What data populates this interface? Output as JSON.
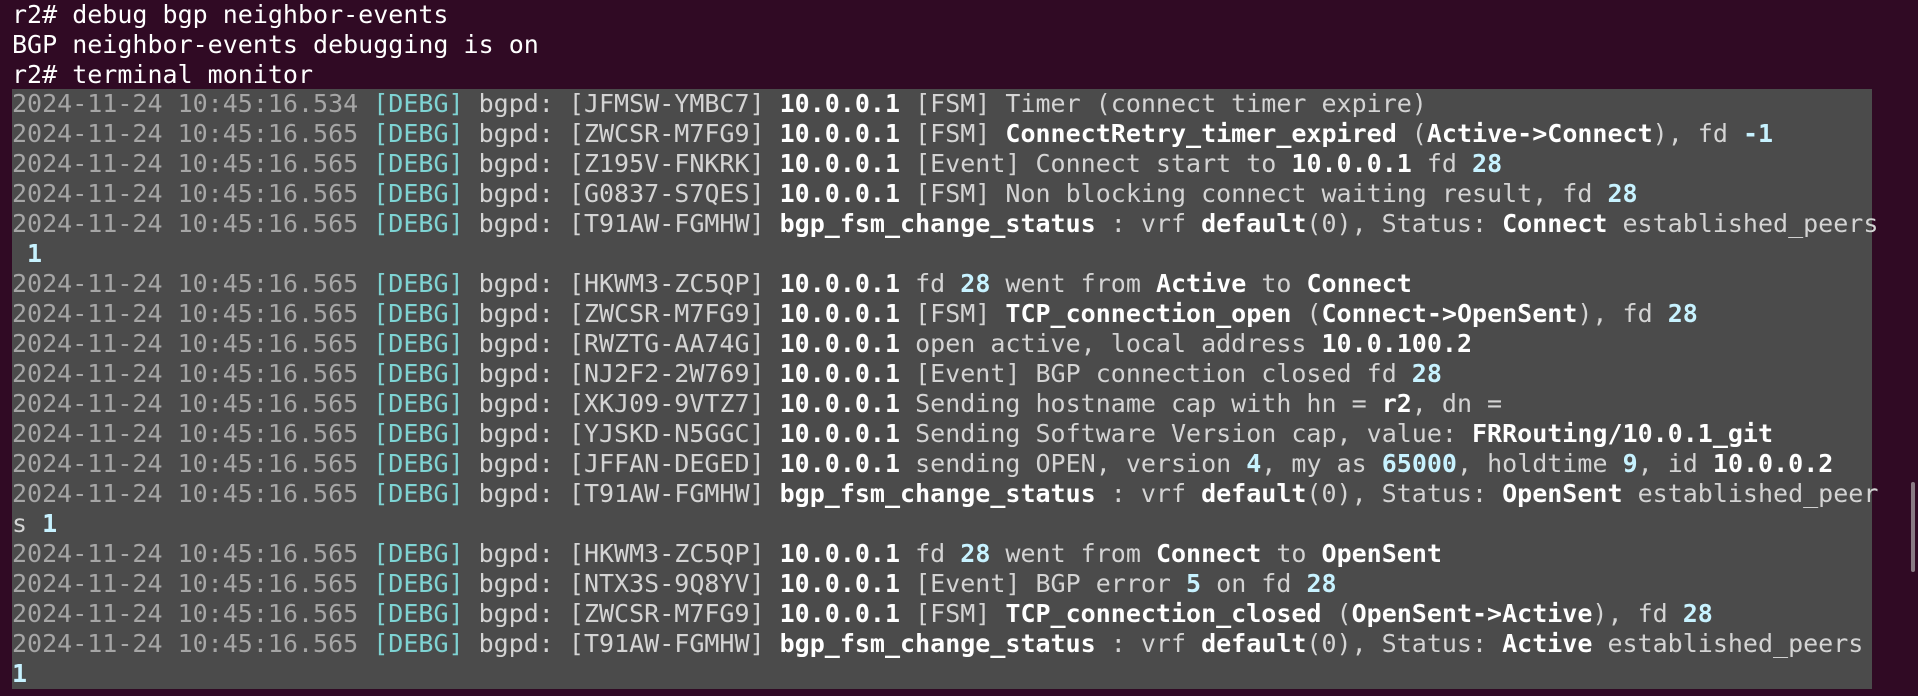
{
  "prompt": [
    "r2# debug bgp neighbor-events",
    "BGP neighbor-events debugging is on",
    "r2# terminal monitor"
  ],
  "lines": [
    {
      "segs": [
        {
          "t": "2024-11-24 10:45:16.534 ",
          "c": "ts"
        },
        {
          "t": "[DEBG]",
          "c": "lvl"
        },
        {
          "t": " bgpd: [JFMSW-YMBC7] ",
          "c": "dim"
        },
        {
          "t": "10.0.0.1",
          "c": "hi"
        },
        {
          "t": " [FSM] Timer (connect timer expire)",
          "c": "dim"
        }
      ]
    },
    {
      "segs": [
        {
          "t": "2024-11-24 10:45:16.565 ",
          "c": "ts"
        },
        {
          "t": "[DEBG]",
          "c": "lvl"
        },
        {
          "t": " bgpd: [ZWCSR-M7FG9] ",
          "c": "dim"
        },
        {
          "t": "10.0.0.1",
          "c": "hi"
        },
        {
          "t": " [FSM] ",
          "c": "dim"
        },
        {
          "t": "ConnectRetry_timer_expired",
          "c": "hi"
        },
        {
          "t": " (",
          "c": "dim"
        },
        {
          "t": "Active->Connect",
          "c": "hi"
        },
        {
          "t": "), fd ",
          "c": "dim"
        },
        {
          "t": "-1",
          "c": "num"
        }
      ]
    },
    {
      "segs": [
        {
          "t": "2024-11-24 10:45:16.565 ",
          "c": "ts"
        },
        {
          "t": "[DEBG]",
          "c": "lvl"
        },
        {
          "t": " bgpd: [Z195V-FNKRK] ",
          "c": "dim"
        },
        {
          "t": "10.0.0.1",
          "c": "hi"
        },
        {
          "t": " [Event] Connect start to ",
          "c": "dim"
        },
        {
          "t": "10.0.0.1",
          "c": "hi"
        },
        {
          "t": " fd ",
          "c": "dim"
        },
        {
          "t": "28",
          "c": "num"
        }
      ]
    },
    {
      "segs": [
        {
          "t": "2024-11-24 10:45:16.565 ",
          "c": "ts"
        },
        {
          "t": "[DEBG]",
          "c": "lvl"
        },
        {
          "t": " bgpd: [G0837-S7QES] ",
          "c": "dim"
        },
        {
          "t": "10.0.0.1",
          "c": "hi"
        },
        {
          "t": " [FSM] Non blocking connect waiting result, fd ",
          "c": "dim"
        },
        {
          "t": "28",
          "c": "num"
        }
      ]
    },
    {
      "segs": [
        {
          "t": "2024-11-24 10:45:16.565 ",
          "c": "ts"
        },
        {
          "t": "[DEBG]",
          "c": "lvl"
        },
        {
          "t": " bgpd: [T91AW-FGMHW] ",
          "c": "dim"
        },
        {
          "t": "bgp_fsm_change_status",
          "c": "hi"
        },
        {
          "t": " : vrf ",
          "c": "dim"
        },
        {
          "t": "default",
          "c": "hi"
        },
        {
          "t": "(0), Status: ",
          "c": "dim"
        },
        {
          "t": "Connect",
          "c": "hi"
        },
        {
          "t": " established_peers",
          "c": "dim"
        }
      ]
    },
    {
      "segs": [
        {
          "t": " 1",
          "c": "num"
        }
      ]
    },
    {
      "segs": [
        {
          "t": "2024-11-24 10:45:16.565 ",
          "c": "ts"
        },
        {
          "t": "[DEBG]",
          "c": "lvl"
        },
        {
          "t": " bgpd: [HKWM3-ZC5QP] ",
          "c": "dim"
        },
        {
          "t": "10.0.0.1",
          "c": "hi"
        },
        {
          "t": " fd ",
          "c": "dim"
        },
        {
          "t": "28",
          "c": "num"
        },
        {
          "t": " went from ",
          "c": "dim"
        },
        {
          "t": "Active",
          "c": "hi"
        },
        {
          "t": " to ",
          "c": "dim"
        },
        {
          "t": "Connect",
          "c": "hi"
        }
      ]
    },
    {
      "segs": [
        {
          "t": "2024-11-24 10:45:16.565 ",
          "c": "ts"
        },
        {
          "t": "[DEBG]",
          "c": "lvl"
        },
        {
          "t": " bgpd: [ZWCSR-M7FG9] ",
          "c": "dim"
        },
        {
          "t": "10.0.0.1",
          "c": "hi"
        },
        {
          "t": " [FSM] ",
          "c": "dim"
        },
        {
          "t": "TCP_connection_open",
          "c": "hi"
        },
        {
          "t": " (",
          "c": "dim"
        },
        {
          "t": "Connect->OpenSent",
          "c": "hi"
        },
        {
          "t": "), fd ",
          "c": "dim"
        },
        {
          "t": "28",
          "c": "num"
        }
      ]
    },
    {
      "segs": [
        {
          "t": "2024-11-24 10:45:16.565 ",
          "c": "ts"
        },
        {
          "t": "[DEBG]",
          "c": "lvl"
        },
        {
          "t": " bgpd: [RWZTG-AA74G] ",
          "c": "dim"
        },
        {
          "t": "10.0.0.1",
          "c": "hi"
        },
        {
          "t": " open active, local address ",
          "c": "dim"
        },
        {
          "t": "10.0.100.2",
          "c": "hi"
        }
      ]
    },
    {
      "segs": [
        {
          "t": "2024-11-24 10:45:16.565 ",
          "c": "ts"
        },
        {
          "t": "[DEBG]",
          "c": "lvl"
        },
        {
          "t": " bgpd: [NJ2F2-2W769] ",
          "c": "dim"
        },
        {
          "t": "10.0.0.1",
          "c": "hi"
        },
        {
          "t": " [Event] BGP connection closed fd ",
          "c": "dim"
        },
        {
          "t": "28",
          "c": "num"
        }
      ]
    },
    {
      "segs": [
        {
          "t": "2024-11-24 10:45:16.565 ",
          "c": "ts"
        },
        {
          "t": "[DEBG]",
          "c": "lvl"
        },
        {
          "t": " bgpd: [XKJ09-9VTZ7] ",
          "c": "dim"
        },
        {
          "t": "10.0.0.1",
          "c": "hi"
        },
        {
          "t": " Sending hostname cap with hn = ",
          "c": "dim"
        },
        {
          "t": "r2",
          "c": "hi"
        },
        {
          "t": ", dn =",
          "c": "dim"
        }
      ]
    },
    {
      "segs": [
        {
          "t": "2024-11-24 10:45:16.565 ",
          "c": "ts"
        },
        {
          "t": "[DEBG]",
          "c": "lvl"
        },
        {
          "t": " bgpd: [YJSKD-N5GGC] ",
          "c": "dim"
        },
        {
          "t": "10.0.0.1",
          "c": "hi"
        },
        {
          "t": " Sending Software Version cap, value: ",
          "c": "dim"
        },
        {
          "t": "FRRouting/10.0.1_git",
          "c": "hi"
        }
      ]
    },
    {
      "segs": [
        {
          "t": "2024-11-24 10:45:16.565 ",
          "c": "ts"
        },
        {
          "t": "[DEBG]",
          "c": "lvl"
        },
        {
          "t": " bgpd: [JFFAN-DEGED] ",
          "c": "dim"
        },
        {
          "t": "10.0.0.1",
          "c": "hi"
        },
        {
          "t": " sending OPEN, version ",
          "c": "dim"
        },
        {
          "t": "4",
          "c": "num"
        },
        {
          "t": ", my as ",
          "c": "dim"
        },
        {
          "t": "65000",
          "c": "num"
        },
        {
          "t": ", holdtime ",
          "c": "dim"
        },
        {
          "t": "9",
          "c": "num"
        },
        {
          "t": ", id ",
          "c": "dim"
        },
        {
          "t": "10.0.0.2",
          "c": "hi"
        }
      ]
    },
    {
      "segs": [
        {
          "t": "2024-11-24 10:45:16.565 ",
          "c": "ts"
        },
        {
          "t": "[DEBG]",
          "c": "lvl"
        },
        {
          "t": " bgpd: [T91AW-FGMHW] ",
          "c": "dim"
        },
        {
          "t": "bgp_fsm_change_status",
          "c": "hi"
        },
        {
          "t": " : vrf ",
          "c": "dim"
        },
        {
          "t": "default",
          "c": "hi"
        },
        {
          "t": "(0), Status: ",
          "c": "dim"
        },
        {
          "t": "OpenSent",
          "c": "hi"
        },
        {
          "t": " established_peer",
          "c": "dim"
        }
      ]
    },
    {
      "segs": [
        {
          "t": "s ",
          "c": "dim"
        },
        {
          "t": "1",
          "c": "num"
        }
      ]
    },
    {
      "segs": [
        {
          "t": "2024-11-24 10:45:16.565 ",
          "c": "ts"
        },
        {
          "t": "[DEBG]",
          "c": "lvl"
        },
        {
          "t": " bgpd: [HKWM3-ZC5QP] ",
          "c": "dim"
        },
        {
          "t": "10.0.0.1",
          "c": "hi"
        },
        {
          "t": " fd ",
          "c": "dim"
        },
        {
          "t": "28",
          "c": "num"
        },
        {
          "t": " went from ",
          "c": "dim"
        },
        {
          "t": "Connect",
          "c": "hi"
        },
        {
          "t": " to ",
          "c": "dim"
        },
        {
          "t": "OpenSent",
          "c": "hi"
        }
      ]
    },
    {
      "segs": [
        {
          "t": "2024-11-24 10:45:16.565 ",
          "c": "ts"
        },
        {
          "t": "[DEBG]",
          "c": "lvl"
        },
        {
          "t": " bgpd: [NTX3S-9Q8YV] ",
          "c": "dim"
        },
        {
          "t": "10.0.0.1",
          "c": "hi"
        },
        {
          "t": " [Event] BGP error ",
          "c": "dim"
        },
        {
          "t": "5",
          "c": "num"
        },
        {
          "t": " on fd ",
          "c": "dim"
        },
        {
          "t": "28",
          "c": "num"
        }
      ]
    },
    {
      "segs": [
        {
          "t": "2024-11-24 10:45:16.565 ",
          "c": "ts"
        },
        {
          "t": "[DEBG]",
          "c": "lvl"
        },
        {
          "t": " bgpd: [ZWCSR-M7FG9] ",
          "c": "dim"
        },
        {
          "t": "10.0.0.1",
          "c": "hi"
        },
        {
          "t": " [FSM] ",
          "c": "dim"
        },
        {
          "t": "TCP_connection_closed",
          "c": "hi"
        },
        {
          "t": " (",
          "c": "dim"
        },
        {
          "t": "OpenSent->Active",
          "c": "hi"
        },
        {
          "t": "), fd ",
          "c": "dim"
        },
        {
          "t": "28",
          "c": "num"
        }
      ]
    },
    {
      "segs": [
        {
          "t": "2024-11-24 10:45:16.565 ",
          "c": "ts"
        },
        {
          "t": "[DEBG]",
          "c": "lvl"
        },
        {
          "t": " bgpd: [T91AW-FGMHW] ",
          "c": "dim"
        },
        {
          "t": "bgp_fsm_change_status",
          "c": "hi"
        },
        {
          "t": " : vrf ",
          "c": "dim"
        },
        {
          "t": "default",
          "c": "hi"
        },
        {
          "t": "(0), Status: ",
          "c": "dim"
        },
        {
          "t": "Active",
          "c": "hi"
        },
        {
          "t": " established_peers",
          "c": "dim"
        }
      ]
    },
    {
      "segs": [
        {
          "t": "1",
          "c": "num"
        }
      ]
    }
  ]
}
